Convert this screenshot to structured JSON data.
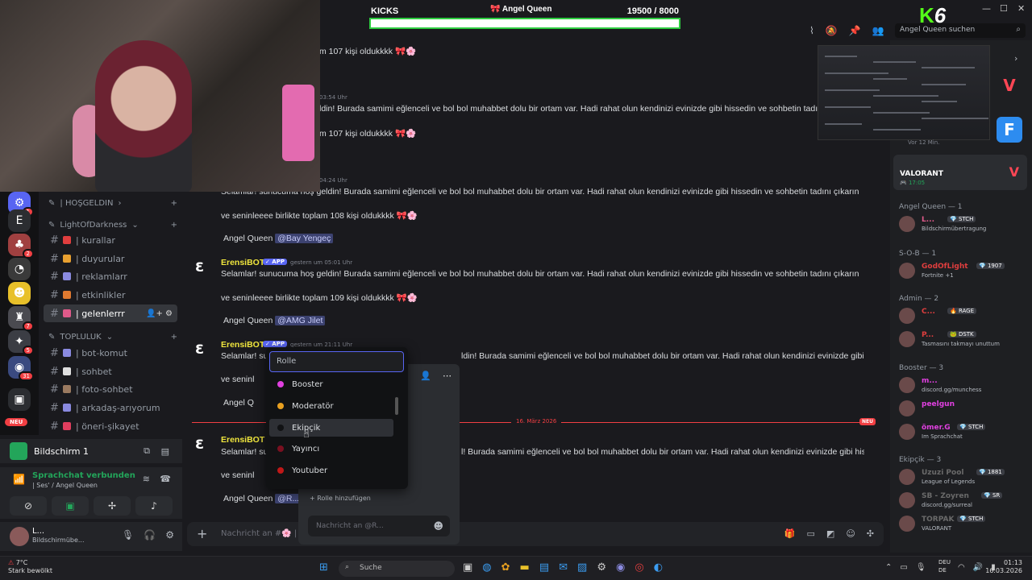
{
  "overlay": {
    "kicks_label": "KICKS",
    "streamer": "Angel Queen",
    "count": "19500  / 8000",
    "progress": 1.0,
    "k_logo": "K",
    "k_number": "6"
  },
  "window_controls": [
    "—",
    "☐",
    "✕"
  ],
  "servers": [
    {
      "icon": "⚙",
      "color": "#5865f2",
      "badge": "1"
    },
    {
      "icon": "E",
      "color": "#2b2d31",
      "badge": ""
    },
    {
      "icon": "♣",
      "color": "#a04040",
      "badge": "2"
    },
    {
      "icon": "◔",
      "color": "#3a3a3a",
      "badge": ""
    },
    {
      "icon": "☻",
      "color": "#e8c02a",
      "badge": ""
    },
    {
      "icon": "♜",
      "color": "#4a4a50",
      "badge": "7"
    },
    {
      "icon": "✦",
      "color": "#3b3d44",
      "badge": "5"
    },
    {
      "icon": "◉",
      "color": "#3a4a80",
      "badge": "31"
    },
    {
      "icon": "▣",
      "color": "#2b2d31",
      "badge": ""
    }
  ],
  "new_pill": "NEU",
  "sidebar": {
    "categories": [
      {
        "label": "| HOŞGELDIN",
        "chev": "›"
      },
      {
        "label": "LightOfDarkness",
        "chev": "⌄"
      },
      {
        "label": "TOPLULUK",
        "chev": "⌄"
      }
    ],
    "channels": [
      {
        "label": "| kurallar",
        "color": "#e03e3e"
      },
      {
        "label": "| duyurular",
        "color": "#e8a030"
      },
      {
        "label": "| reklamlarr",
        "color": "#8a8ae0"
      },
      {
        "label": "| etkinlikler",
        "color": "#e07a30"
      },
      {
        "label": "| gelenlerrr",
        "color": "#e05a8a"
      },
      {
        "label": "| bot-komut",
        "color": "#8a8ae0"
      },
      {
        "label": "| sohbet",
        "color": "#e0e0e0"
      },
      {
        "label": "| foto-sohbet",
        "color": "#9a7a60"
      },
      {
        "label": "| arkadaş-arıyorum",
        "color": "#8a8ae0"
      },
      {
        "label": "| öneri-şikayet",
        "color": "#e03e5e"
      }
    ]
  },
  "screenshare": {
    "label": "Bildschirm 1"
  },
  "voice": {
    "status": "Sprachchat verbunden",
    "channel": "| Ses' / Angel Queen"
  },
  "user_panel": {
    "name": "L...",
    "activity": "Bildschirmübe..."
  },
  "chat": {
    "lines": [
      {
        "text": "m  107 kişi oldukkkk 🎀🌸"
      },
      {
        "text": "03:54 Uhr"
      },
      {
        "text": "ldin! Burada samimi eğlenceli ve bol bol muhabbet dolu bir ortam var. Hadi rahat olun kendinizi evinizde gibi hissedin ve sohbetin tadını çı"
      },
      {
        "text": "m  107 kişi oldukkkk 🎀🌸"
      },
      {
        "text": "04:24 Uhr"
      },
      {
        "text": "Selamlar! sunucuma hoş geldin! Burada samimi eğlenceli ve bol bol muhabbet dolu bir ortam var. Hadi rahat olun kendinizi evinizde gibi hissedin ve sohbetin tadını çıkarın"
      },
      {
        "text": "ve seninleeee birlikte toplam  108 kişi oldukkkk 🎀🌸"
      },
      {
        "text": "Angel Queen"
      },
      {
        "text": "@Bay Yengeç"
      }
    ],
    "msg2": {
      "author": "ErensiBOT",
      "app": "✓ APP",
      "time": "gestern um 05:01 Uhr",
      "line1": "Selamlar! sunucuma hoş geldin! Burada samimi eğlenceli ve bol bol muhabbet dolu bir ortam var. Hadi rahat olun kendinizi evinizde gibi hissedin ve sohbetin tadını çıkarın",
      "line2": "ve seninleeee birlikte toplam  109 kişi oldukkkk 🎀🌸",
      "reply_user": "Angel Queen",
      "mention": "@AMG Jilet"
    },
    "msg3": {
      "author": "ErensiBOT",
      "app": "✓ APP",
      "time": "gestern um 21:11 Uhr",
      "line1": "Selamlar! su",
      "line1b": "ldin! Burada samimi eğlenceli ve bol bol muhabbet dolu bir ortam var. Hadi rahat olun kendinizi evinizde gibi hissedin ve sohbetin tadını çıkarın",
      "line2": "ve seninl",
      "reply_user": "Angel Q"
    },
    "date_sep": "16. März 2026",
    "date_new": "NEU",
    "msg4": {
      "author": "ErensiBOT",
      "line1": "Selamlar! su",
      "line1b": "l! Burada samimi eğlenceli ve bol bol muhabbet dolu bir ortam var. Hadi rahat olun kendinizi evinizde gibi hissedin ve sohbetin tadını çıkarın",
      "line2": "ve seninl",
      "reply_user": "Angel Queen",
      "mention": "@R..."
    },
    "composer_placeholder": "Nachricht an #🌸 | g"
  },
  "role_popup": {
    "placeholder": "Rolle",
    "roles": [
      {
        "label": "Booster",
        "color": "#e040e0"
      },
      {
        "label": "Moderatör",
        "color": "#e8a020"
      },
      {
        "label": "Ekipçik",
        "color": "#111214"
      },
      {
        "label": "Yayıncı",
        "color": "#7a1020"
      },
      {
        "label": "Youtuber",
        "color": "#c01818"
      }
    ],
    "add_role": "+ Rolle hinzufügen",
    "message_placeholder": "Nachricht an @R..."
  },
  "search": {
    "placeholder": "Angel Queen suchen"
  },
  "members": {
    "live_label": "Vor 12 Min.",
    "val_card": {
      "title": "VALORANT",
      "sub": "🎮 17:05"
    },
    "groups": [
      {
        "label": "Angel Queen — 1",
        "members": [
          {
            "name": "L...",
            "tag": "💎 STCH",
            "activity": "Bildschirmübertragung",
            "color": "#e05a8a"
          }
        ]
      },
      {
        "label": "S-O-B — 1",
        "members": [
          {
            "name": "GodOfLight",
            "tag": "💎 1907",
            "activity": "Fortnite +1",
            "color": "#e03e3e"
          }
        ]
      },
      {
        "label": "Admin — 2",
        "members": [
          {
            "name": "C...",
            "tag": "🔥 RAGE",
            "activity": "",
            "color": "#e03e3e"
          },
          {
            "name": "P...",
            "tag": "🐸 DSTK",
            "activity": "Tasmasını takmayı unuttum",
            "color": "#e03e3e"
          }
        ]
      },
      {
        "label": "Booster — 3",
        "members": [
          {
            "name": "m...",
            "tag": "",
            "activity": "discord.gg/munchess",
            "color": "#e040e0"
          },
          {
            "name": "peelgun",
            "tag": "",
            "activity": "",
            "color": "#e040e0"
          },
          {
            "name": "ömer.G",
            "tag": "💎 STCH",
            "activity": "Im Sprachchat",
            "color": "#e040e0"
          }
        ]
      },
      {
        "label": "Ekipçik — 3",
        "members": [
          {
            "name": "Uzuzi Pool",
            "tag": "💎 1881",
            "activity": "League of Legends",
            "color": "#6a6a6a"
          },
          {
            "name": "SB - Zoyren",
            "tag": "💎 SR",
            "activity": "discord.gg/surreal",
            "color": "#6a6a6a"
          },
          {
            "name": "TORPAK",
            "tag": "💎 STCH",
            "activity": "VALORANT",
            "color": "#6a6a6a"
          }
        ]
      }
    ]
  },
  "taskbar": {
    "weather_temp": "7°C",
    "weather_desc": "Stark bewölkt",
    "search": "Suche",
    "lang1": "DEU",
    "lang2": "DE",
    "time": "01:13",
    "date": "16.03.2026"
  }
}
